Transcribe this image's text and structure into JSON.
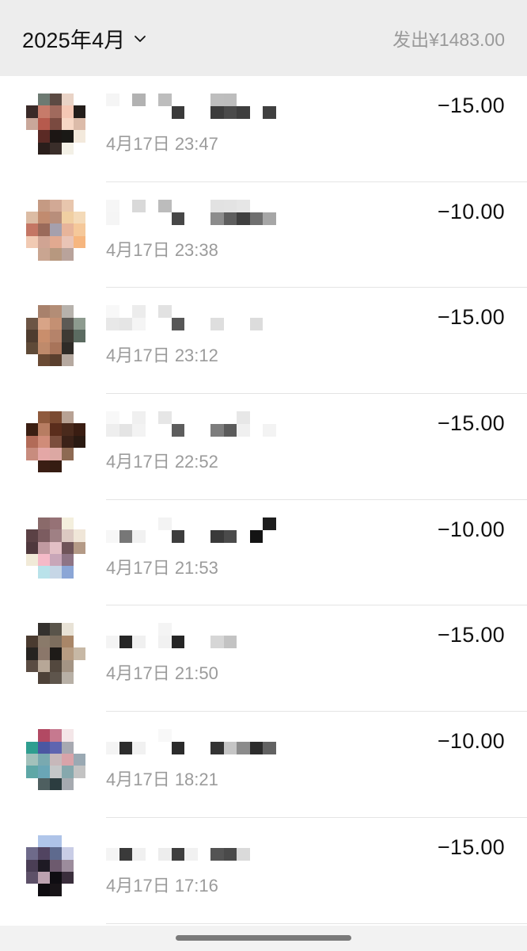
{
  "header": {
    "month_label": "2025年4月",
    "summary": "发出¥1483.00"
  },
  "transactions": [
    {
      "time": "4月17日 23:47",
      "amount": "−15.00",
      "name_blocks": [
        "#f5f5f5",
        "#ffffff",
        "#b2b2b2",
        "#ffffff",
        "#bdbdbd",
        "#ffffff",
        "#ffffff",
        "#ffffff",
        "#bebebe",
        "#bdbdbd",
        "#ffffff",
        "#ffffff",
        "#ffffff"
      ],
      "name_blocks2": [
        "#ffffff",
        "#ffffff",
        "#ffffff",
        "#ffffff",
        "#ffffff",
        "#3a3a3a",
        "#ffffff",
        "#ffffff",
        "#3c3c3c",
        "#4a4a4a",
        "#3e3e3e",
        "#ffffff",
        "#404040"
      ],
      "avatar": [
        "#ffffff",
        "#6d7a72",
        "#5b4a43",
        "#e9d3c6",
        "#ffffff",
        "#3a2a28",
        "#c77b6a",
        "#a06a5d",
        "#f5c8b5",
        "#231d1a",
        "#c9a79a",
        "#b65a4d",
        "#7a4a40",
        "#f7d7c5",
        "#dcbba9",
        "#ffffff",
        "#5b2a25",
        "#1c1614",
        "#1a1916",
        "#f3e9dc",
        "#ffffff",
        "#2a1e1b",
        "#3a2e2a",
        "#f3f0e6",
        "#ffffff"
      ]
    },
    {
      "time": "4月17日 23:38",
      "amount": "−10.00",
      "name_blocks": [
        "#f6f6f6",
        "#ffffff",
        "#d9d9d9",
        "#ffffff",
        "#bcbcbc",
        "#ffffff",
        "#ffffff",
        "#ffffff",
        "#e2e2e2",
        "#e3e3e3",
        "#e6e6e6",
        "#ffffff",
        "#ffffff"
      ],
      "name_blocks2": [
        "#f5f5f5",
        "#ffffff",
        "#ffffff",
        "#ffffff",
        "#ffffff",
        "#474747",
        "#ffffff",
        "#ffffff",
        "#8c8c8c",
        "#5e5e5e",
        "#3f3f3f",
        "#6f6f6f",
        "#a6a6a6"
      ],
      "avatar": [
        "#ffffff",
        "#c59a83",
        "#d2a995",
        "#e8c6ad",
        "#ffffff",
        "#dcbca4",
        "#c18b6f",
        "#b88e7b",
        "#f0cfa2",
        "#f4dab8",
        "#c47664",
        "#9a6a5a",
        "#a5a0ad",
        "#e7b49a",
        "#f5c89a",
        "#f1cab3",
        "#d0a493",
        "#e1a990",
        "#e9c4b6",
        "#f6b67f",
        "#ffffff",
        "#c9a591",
        "#b7987f",
        "#b9a39b",
        "#ffffff"
      ]
    },
    {
      "time": "4月17日 23:12",
      "amount": "−15.00",
      "name_blocks": [
        "#f8f8f8",
        "#ffffff",
        "#ececec",
        "#ffffff",
        "#e2e2e2",
        "#ffffff",
        "#ffffff",
        "#ffffff",
        "#ffffff",
        "#ffffff",
        "#ffffff",
        "#ffffff",
        "#ffffff"
      ],
      "name_blocks2": [
        "#e8e8e8",
        "#e5e5e5",
        "#f5f5f5",
        "#ffffff",
        "#ffffff",
        "#575757",
        "#ffffff",
        "#ffffff",
        "#dedede",
        "#ffffff",
        "#ffffff",
        "#dcdcdc",
        "#ffffff"
      ],
      "avatar": [
        "#ffffff",
        "#a8816c",
        "#b38d76",
        "#b7b2ac",
        "#ffffff",
        "#6c5545",
        "#d8a487",
        "#c49073",
        "#5c5a55",
        "#8d9b8f",
        "#4e3c2f",
        "#c98e6c",
        "#b5836a",
        "#3e3a34",
        "#5b6b61",
        "#5f4a38",
        "#bf8a6b",
        "#a8745a",
        "#2f2b27",
        "#ffffff",
        "#ffffff",
        "#6a4a34",
        "#5a3f2e",
        "#b6a9a0",
        "#ffffff"
      ]
    },
    {
      "time": "4月17日 22:52",
      "amount": "−15.00",
      "name_blocks": [
        "#f8f8f8",
        "#ffffff",
        "#f0f0f0",
        "#ffffff",
        "#e6e6e6",
        "#ffffff",
        "#ffffff",
        "#ffffff",
        "#ffffff",
        "#ffffff",
        "#e7e7e7",
        "#ffffff",
        "#ffffff"
      ],
      "name_blocks2": [
        "#eeeeee",
        "#e4e4e4",
        "#f3f3f3",
        "#ffffff",
        "#ffffff",
        "#5d5d5d",
        "#ffffff",
        "#ffffff",
        "#7d7d7d",
        "#5b5b5b",
        "#f0f0f0",
        "#ffffff",
        "#f3f3f3"
      ],
      "avatar": [
        "#ffffff",
        "#8f5a3d",
        "#7a4a31",
        "#b8a294",
        "#ffffff",
        "#3a1e12",
        "#b77d62",
        "#5a2d1c",
        "#4a2a1c",
        "#3a1d12",
        "#b26b58",
        "#d08c79",
        "#7b4e3d",
        "#3b2218",
        "#2a1a12",
        "#c88c7e",
        "#e4a7a6",
        "#dca8a3",
        "#8e6a53",
        "#ffffff",
        "#ffffff",
        "#3a1e14",
        "#351c12",
        "#ffffff",
        "#ffffff"
      ]
    },
    {
      "time": "4月17日 21:53",
      "amount": "−10.00",
      "name_blocks": [
        "#ffffff",
        "#ffffff",
        "#ffffff",
        "#ffffff",
        "#f3f3f3",
        "#ffffff",
        "#ffffff",
        "#ffffff",
        "#ffffff",
        "#ffffff",
        "#ffffff",
        "#ffffff",
        "#1e1e1e"
      ],
      "name_blocks2": [
        "#f7f7f7",
        "#777777",
        "#f1f1f1",
        "#ffffff",
        "#ffffff",
        "#3d3d3d",
        "#ffffff",
        "#ffffff",
        "#3a3a3a",
        "#4b4b4b",
        "#ffffff",
        "#141414",
        "#ffffff"
      ],
      "avatar": [
        "#ffffff",
        "#8a6a6a",
        "#967276",
        "#f4efdd",
        "#ffffff",
        "#5b4145",
        "#7c5c60",
        "#9f8084",
        "#dcc9c2",
        "#f0e6d8",
        "#4f383d",
        "#c19aa1",
        "#e2bfc5",
        "#6f5459",
        "#b49a86",
        "#f1ead8",
        "#f5bac8",
        "#c8a6b8",
        "#8e7485",
        "#ffffff",
        "#ffffff",
        "#b9e2ea",
        "#c6d6e6",
        "#8ba6d6",
        "#ffffff"
      ]
    },
    {
      "time": "4月17日 21:50",
      "amount": "−15.00",
      "name_blocks": [
        "#ffffff",
        "#ffffff",
        "#ffffff",
        "#ffffff",
        "#f4f4f4",
        "#ffffff",
        "#ffffff",
        "#ffffff",
        "#ffffff",
        "#ffffff",
        "#ffffff",
        "#ffffff",
        "#ffffff"
      ],
      "name_blocks2": [
        "#f4f4f4",
        "#262626",
        "#f0f0f0",
        "#ffffff",
        "#f1f1f1",
        "#262626",
        "#ffffff",
        "#ffffff",
        "#d6d6d6",
        "#c3c3c3",
        "#ffffff",
        "#ffffff",
        "#ffffff"
      ],
      "avatar": [
        "#ffffff",
        "#34312e",
        "#59544a",
        "#e8e2d6",
        "#ffffff",
        "#4a3b30",
        "#8a7a6a",
        "#7d6e5e",
        "#a98668",
        "#ffffff",
        "#262320",
        "#8b776a",
        "#1e1b18",
        "#b79c82",
        "#c7b8a5",
        "#5a4c43",
        "#b7a797",
        "#53483e",
        "#a49484",
        "#ffffff",
        "#ffffff",
        "#4d4138",
        "#5e554c",
        "#b8b0a6",
        "#ffffff"
      ]
    },
    {
      "time": "4月17日 18:21",
      "amount": "−10.00",
      "name_blocks": [
        "#ffffff",
        "#ffffff",
        "#ffffff",
        "#ffffff",
        "#f8f8f8",
        "#ffffff",
        "#ffffff",
        "#ffffff",
        "#ffffff",
        "#ffffff",
        "#ffffff",
        "#ffffff",
        "#ffffff"
      ],
      "name_blocks2": [
        "#f4f4f4",
        "#2d2d2d",
        "#f1f1f1",
        "#ffffff",
        "#ffffff",
        "#2b2b2b",
        "#ffffff",
        "#ffffff",
        "#343434",
        "#c5c5c5",
        "#8b8b8b",
        "#2c2c2c",
        "#626262"
      ],
      "avatar": [
        "#ffffff",
        "#b24963",
        "#c6798f",
        "#f4e6e8",
        "#ffffff",
        "#2f9e90",
        "#4b57a2",
        "#5f65b0",
        "#a7a9b1",
        "#ffffff",
        "#a2c1bb",
        "#79a9b0",
        "#c7b8ba",
        "#d8a3a9",
        "#9aa9b3",
        "#5ea7a6",
        "#6aa6b6",
        "#c4c7c8",
        "#86a8ad",
        "#c3c3c3",
        "#ffffff",
        "#4e5f60",
        "#2c3d40",
        "#a6aab0",
        "#ffffff"
      ]
    },
    {
      "time": "4月17日 17:16",
      "amount": "−15.00",
      "name_blocks": [
        "#ffffff",
        "#ffffff",
        "#ffffff",
        "#ffffff",
        "#ffffff",
        "#ffffff",
        "#ffffff",
        "#ffffff",
        "#ffffff",
        "#ffffff",
        "#ffffff",
        "#ffffff",
        "#ffffff"
      ],
      "name_blocks2": [
        "#f4f4f4",
        "#3a3a3a",
        "#f0f0f0",
        "#ffffff",
        "#ededed",
        "#3e3e3e",
        "#f1f1f1",
        "#ffffff",
        "#545454",
        "#4a4a4a",
        "#dadada",
        "#ffffff",
        "#ffffff"
      ],
      "avatar": [
        "#ffffff",
        "#b0c6ea",
        "#aec3e8",
        "#ffffff",
        "#ffffff",
        "#6e6a8a",
        "#514461",
        "#5e6a8e",
        "#c9cde6",
        "#ffffff",
        "#4a3e55",
        "#1e1a24",
        "#6d5a6e",
        "#9c8c9c",
        "#ffffff",
        "#5d5068",
        "#bca2b0",
        "#0f0d12",
        "#3a2e3c",
        "#ffffff",
        "#ffffff",
        "#0e0b10",
        "#181418",
        "#ffffff",
        "#ffffff"
      ]
    }
  ]
}
